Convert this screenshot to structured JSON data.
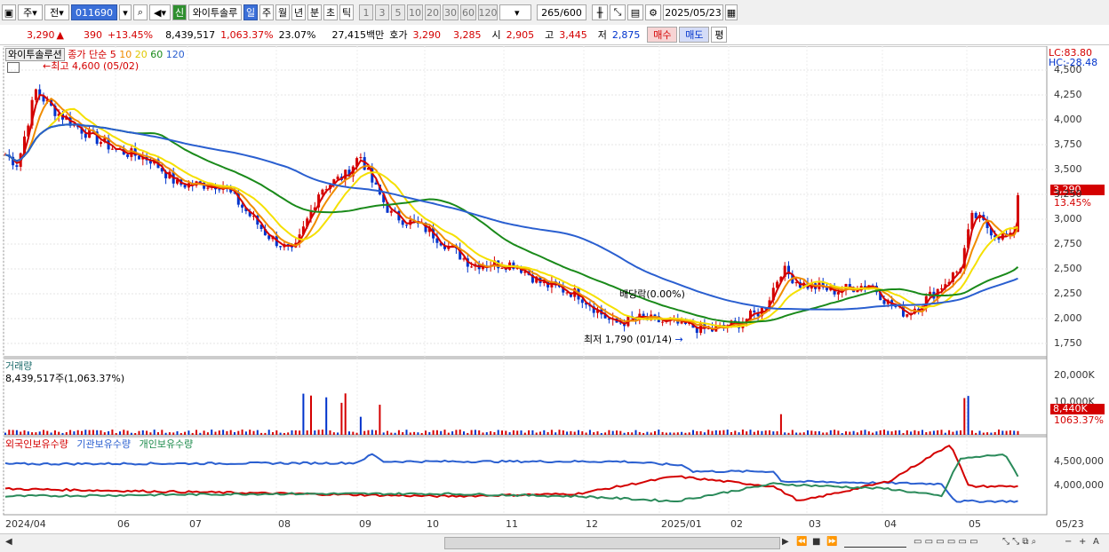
{
  "toolbar": {
    "type_label": "주",
    "prev_label": "전",
    "code": "011690",
    "stock_name": "와이투솔루",
    "stock_badge": "신",
    "periods": [
      "일",
      "주",
      "월",
      "년",
      "분",
      "초",
      "틱"
    ],
    "intervals": [
      "1",
      "3",
      "5",
      "10",
      "20",
      "30",
      "60",
      "120"
    ],
    "count": "265/600",
    "date": "2025/05/23"
  },
  "quote": {
    "price": "3,290",
    "arrow": "▲",
    "change": "390",
    "change_pct": "+13.45%",
    "volume": "8,439,517",
    "volume_pct": "1,063.37%",
    "turnover": "23.07%",
    "amount": "27,415백만",
    "hoga_label": "호가",
    "bid": "3,290",
    "ask": "3,285",
    "open_label": "시",
    "open": "2,905",
    "high_label": "고",
    "high": "3,445",
    "low_label": "저",
    "low": "2,875",
    "buy_label": "매수",
    "sell_label": "매도",
    "avg_label": "평"
  },
  "price_panel": {
    "name": "와이투솔루션",
    "legend_prefix": "종가 단순",
    "ma": [
      {
        "p": "5",
        "color": "#d40000"
      },
      {
        "p": "10",
        "color": "#f08c00"
      },
      {
        "p": "20",
        "color": "#f5e000"
      },
      {
        "p": "60",
        "color": "#1a8a1a"
      },
      {
        "p": "120",
        "color": "#2a5fd0"
      }
    ],
    "lc": "LC:83.80",
    "hc": "HC:-28.48",
    "high_note": "최고 4,600 (05/02)",
    "low_note": "최저 1,790 (01/14)",
    "div_note": "배당락(0.00%)",
    "cur_price": "3,290",
    "cur_pct": "13.45%",
    "yticks": [
      "4,500",
      "4,250",
      "4,000",
      "3,750",
      "3,500",
      "3,250",
      "3,000",
      "2,750",
      "2,500",
      "2,250",
      "2,000",
      "1,750"
    ]
  },
  "volume_panel": {
    "title": "거래량",
    "value": "8,439,517주(1,063.37%)",
    "yticks": [
      "20,000K",
      "10,000K"
    ],
    "cur": "8,440K",
    "cur_pct": "1063.37%"
  },
  "holding_panel": {
    "s1": "외국인보유수량",
    "s2": "기관보유수량",
    "s3": "개인보유수량",
    "yticks": [
      "4,500,000",
      "4,000,000"
    ]
  },
  "xaxis": [
    "2024/04",
    "06",
    "07",
    "08",
    "09",
    "10",
    "11",
    "12",
    "2025/01",
    "02",
    "03",
    "04",
    "05",
    "05/23"
  ],
  "colors": {
    "up": "#d40000",
    "down": "#0033cc"
  }
}
